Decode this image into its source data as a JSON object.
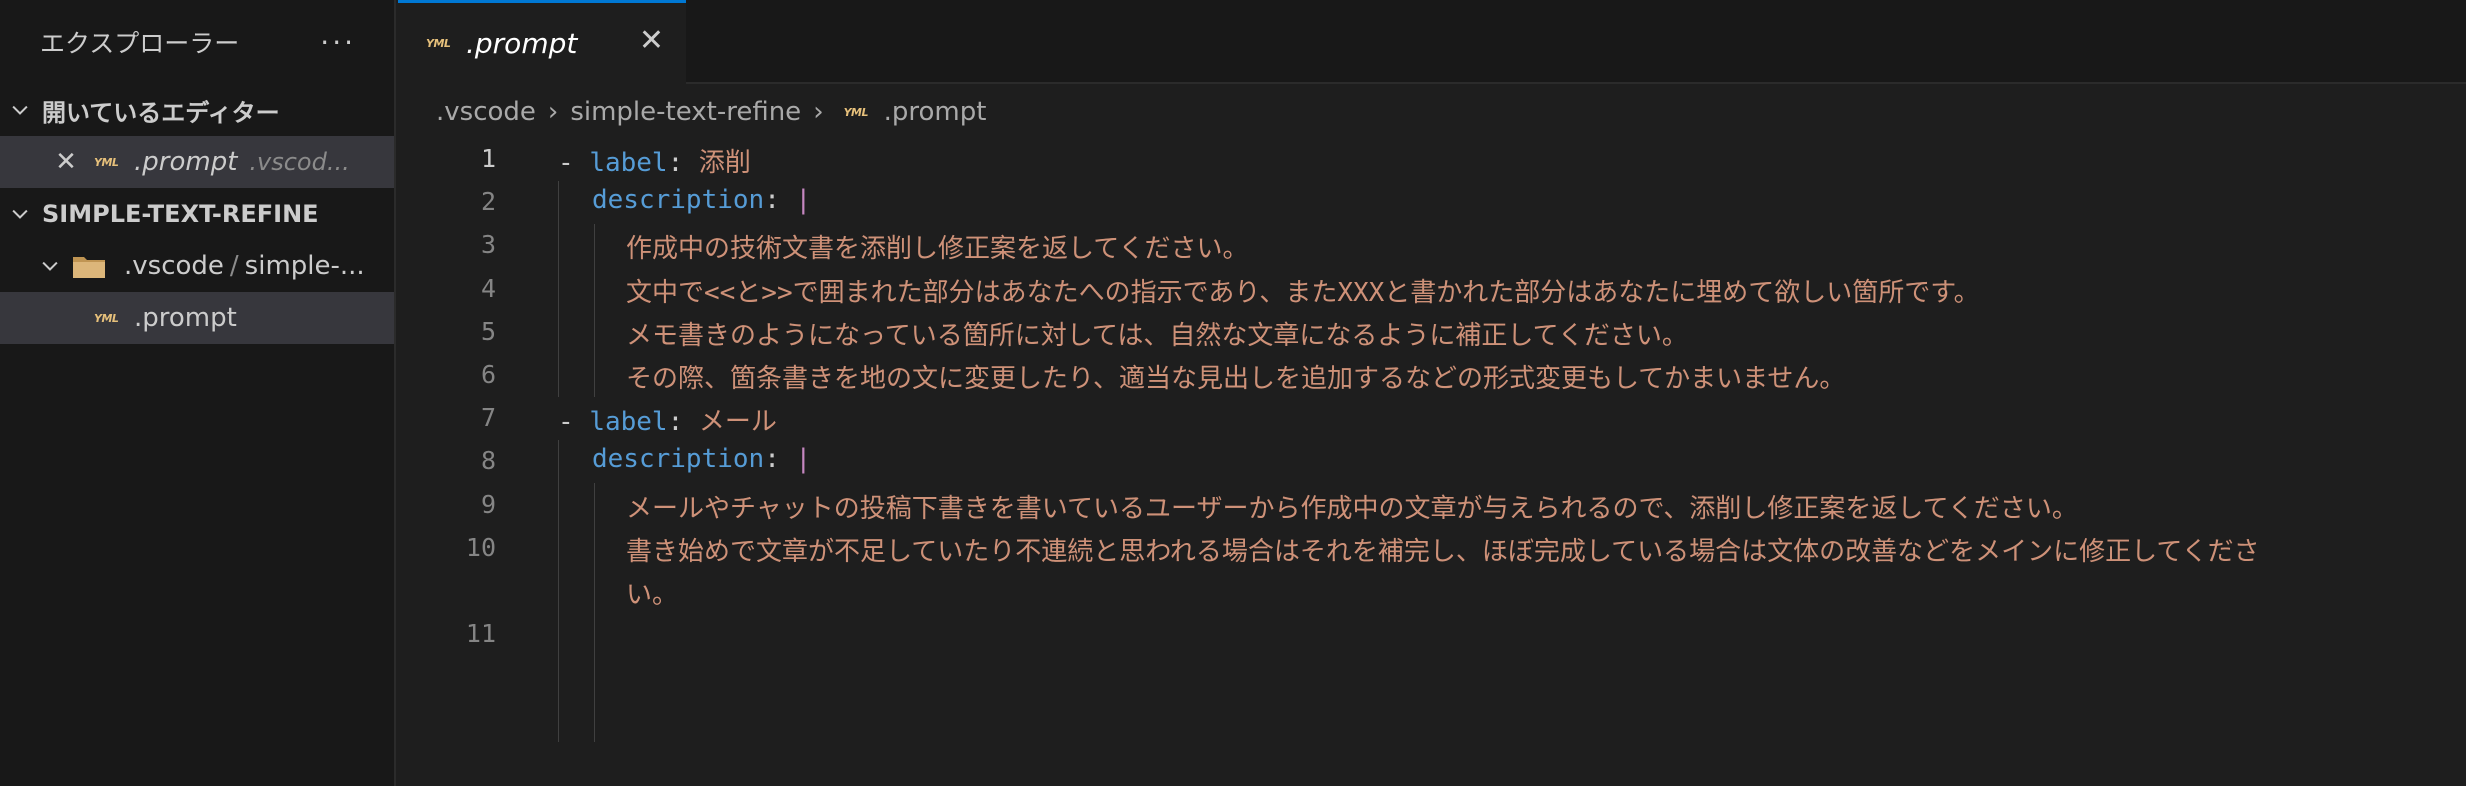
{
  "sidebar": {
    "title": "エクスプローラー",
    "more": "···",
    "open_editors": {
      "heading": "開いているエディター",
      "item": {
        "name": ".prompt",
        "path": ".vscod..."
      }
    },
    "project": {
      "heading": "SIMPLE-TEXT-REFINE",
      "folder": {
        "name1": ".vscode",
        "sep": "/",
        "name2": "simple-..."
      },
      "file": ".prompt"
    }
  },
  "tab": {
    "label": ".prompt",
    "close": "✕"
  },
  "breadcrumb": {
    "part1": ".vscode",
    "part2": "simple-text-refine",
    "part3": ".prompt"
  },
  "icons": {
    "yaml_badge": "YML",
    "yaml_color": "#e6c07b"
  },
  "code": {
    "line_numbers": [
      "1",
      "2",
      "3",
      "4",
      "5",
      "6",
      "7",
      "8",
      "9",
      "10",
      "",
      "11"
    ],
    "l1_dash": "-",
    "l1_key": "label",
    "l1_colon": ":",
    "l1_val": "添削",
    "l2_key": "description",
    "l2_colon": ":",
    "l2_pipe": "|",
    "l3": "作成中の技術文書を添削し修正案を返してください。",
    "l4": "文中で<<と>>で囲まれた部分はあなたへの指示であり、またXXXと書かれた部分はあなたに埋めて欲しい箇所です。",
    "l5": "メモ書きのようになっている箇所に対しては、自然な文章になるように補正してください。",
    "l6": "その際、箇条書きを地の文に変更したり、適当な見出しを追加するなどの形式変更もしてかまいません。",
    "l7_dash": "-",
    "l7_key": "label",
    "l7_colon": ":",
    "l7_val": "メール",
    "l8_key": "description",
    "l8_colon": ":",
    "l8_pipe": "|",
    "l9": "メールやチャットの投稿下書きを書いているユーザーから作成中の文章が与えられるので、添削し修正案を返してください。",
    "l10a": "書き始めで文章が不足していたり不連続と思われる場合はそれを補完し、ほぼ完成している場合は文体の改善などをメインに修正してくださ",
    "l10b": "い。"
  }
}
